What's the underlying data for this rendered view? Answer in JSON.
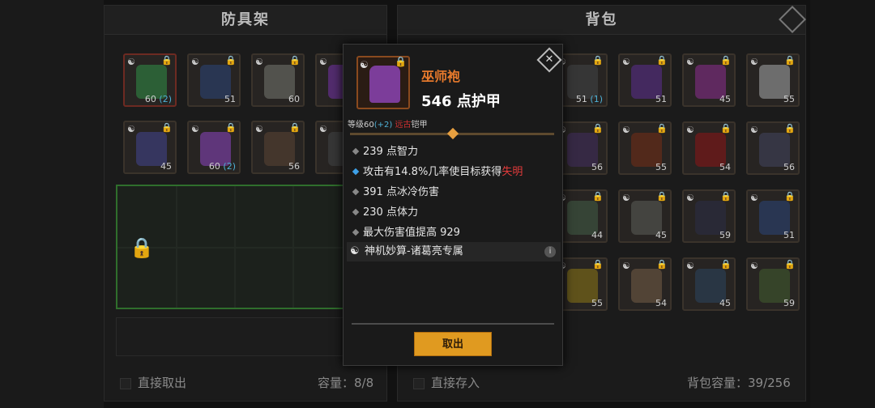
{
  "left_panel": {
    "title": "防具架",
    "footer_action": "直接取出",
    "capacity": "容量：8/8",
    "items": [
      {
        "level": "60",
        "plus": "(2)",
        "art_color": "#2e6a3a",
        "border": "red"
      },
      {
        "level": "51",
        "plus": "",
        "art_color": "#2a3a5a",
        "border": "brown"
      },
      {
        "level": "60",
        "plus": "",
        "art_color": "#5a5a55",
        "border": "brown"
      },
      {
        "level": "",
        "plus": "",
        "art_color": "#5a2e7a",
        "border": "brown"
      },
      {
        "level": "45",
        "plus": "",
        "art_color": "#3a3a6a",
        "border": "brown"
      },
      {
        "level": "60",
        "plus": "(2)",
        "art_color": "#6a3a8a",
        "border": "brown"
      },
      {
        "level": "56",
        "plus": "",
        "art_color": "#4a3a2e",
        "border": "brown"
      },
      {
        "level": "",
        "plus": "",
        "art_color": "#3a3a3a",
        "border": "brown"
      }
    ]
  },
  "right_panel": {
    "title": "背包",
    "footer_action": "直接存入",
    "capacity": "背包容量：39/256",
    "items": [
      {
        "level": "51",
        "plus": "(1)",
        "art_color": "#3a3a3a"
      },
      {
        "level": "51",
        "plus": "",
        "art_color": "#4a2a6a"
      },
      {
        "level": "45",
        "plus": "",
        "art_color": "#6a2a6a"
      },
      {
        "level": "55",
        "plus": "",
        "art_color": "#7a7a7a"
      },
      {
        "level": "56",
        "plus": "",
        "art_color": "#3a2a4a"
      },
      {
        "level": "55",
        "plus": "",
        "art_color": "#5a2a1a"
      },
      {
        "level": "54",
        "plus": "",
        "art_color": "#6a1a1a"
      },
      {
        "level": "56",
        "plus": "",
        "art_color": "#3a3a4a"
      },
      {
        "level": "44",
        "plus": "",
        "art_color": "#3a4a3a"
      },
      {
        "level": "45",
        "plus": "",
        "art_color": "#4a4a45"
      },
      {
        "level": "59",
        "plus": "",
        "art_color": "#2a2a3a"
      },
      {
        "level": "51",
        "plus": "",
        "art_color": "#2a3a5a"
      },
      {
        "level": "55",
        "plus": "",
        "art_color": "#6a5a1a"
      },
      {
        "level": "54",
        "plus": "",
        "art_color": "#5a4a3a"
      },
      {
        "level": "45",
        "plus": "",
        "art_color": "#2a3a4a"
      },
      {
        "level": "59",
        "plus": "",
        "art_color": "#3a4a2a"
      }
    ]
  },
  "popup": {
    "item_name": "巫师袍",
    "armor": "546 点护甲",
    "level_label": "等级60",
    "level_plus": "(+2)",
    "class_tag": "远古",
    "type_label": "铠甲",
    "stats": [
      {
        "text": "239 点智力",
        "kind": "normal"
      },
      {
        "text": "攻击有14.8%几率使目标获得",
        "highlight": "失明",
        "kind": "blue"
      },
      {
        "text": "391 点冰冷伤害",
        "kind": "normal"
      },
      {
        "text": "230 点体力",
        "kind": "normal"
      },
      {
        "text": "最大伤害值提高 929",
        "kind": "normal"
      }
    ],
    "set_name": "神机妙算-诸葛亮专属",
    "take_button": "取出"
  },
  "colors": {
    "item_name": "#e87a2c",
    "accent_button": "#e09a20",
    "plus_value": "#4fb1d6",
    "highlight_red": "#e33b3b"
  }
}
